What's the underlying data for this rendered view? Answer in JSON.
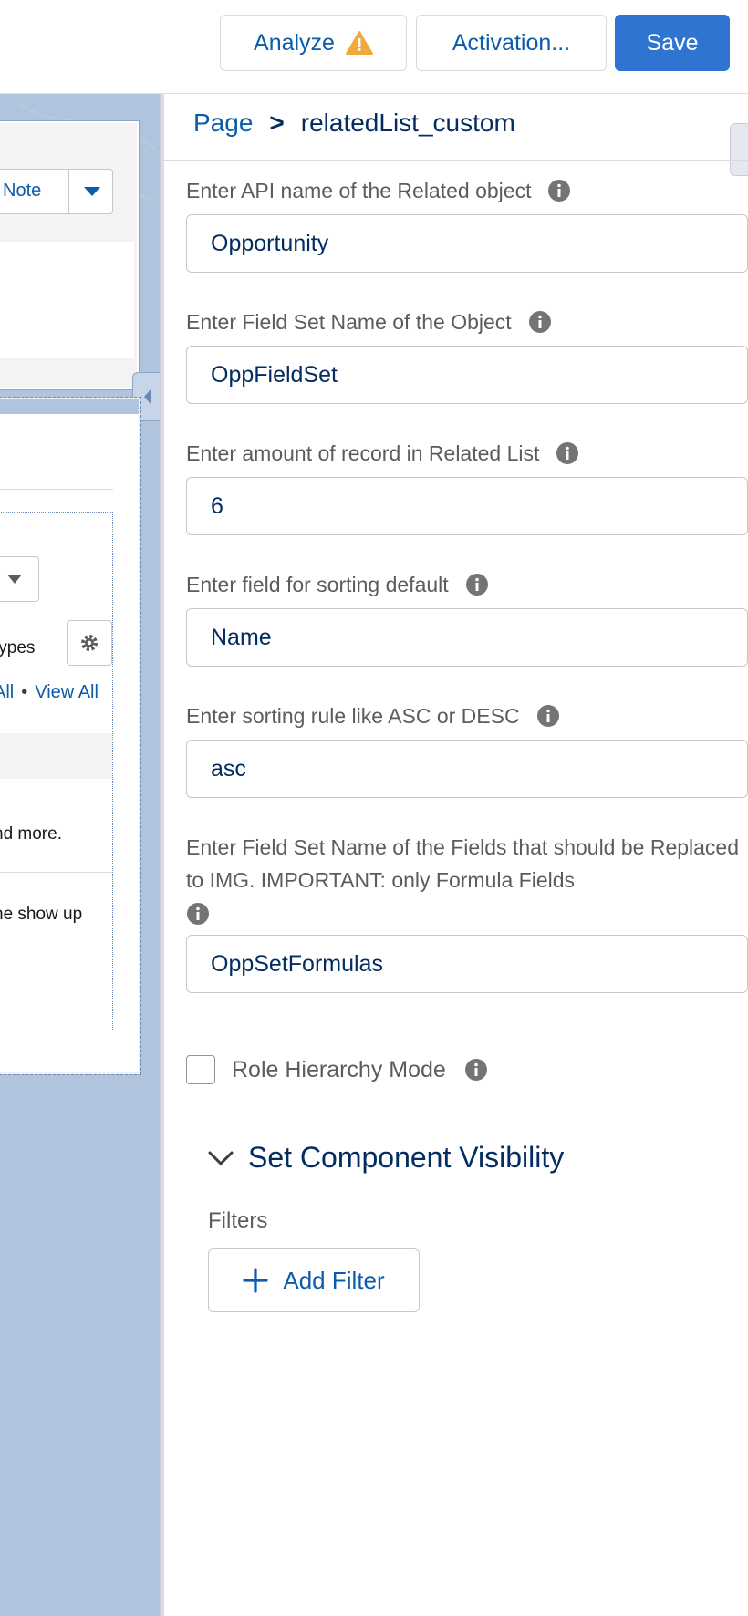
{
  "toolbar": {
    "analyze_label": "Analyze",
    "activation_label": "Activation...",
    "save_label": "Save"
  },
  "canvas": {
    "note_button_label": "Note",
    "types_text": "types",
    "link_all": "All",
    "link_view_all": "View All",
    "more_text": "nd more.",
    "show_up_text": "he show up"
  },
  "panel": {
    "breadcrumb": {
      "parent": "Page",
      "separator": ">",
      "current": "relatedList_custom"
    },
    "fields": [
      {
        "label": "Enter API name of the Related object",
        "value": "Opportunity"
      },
      {
        "label": "Enter Field Set Name of the Object",
        "value": "OppFieldSet"
      },
      {
        "label": "Enter amount of record in Related List",
        "value": "6"
      },
      {
        "label": "Enter field for sorting default",
        "value": "Name"
      },
      {
        "label": "Enter sorting rule like ASC or DESC",
        "value": "asc"
      },
      {
        "label": "Enter Field Set Name of the Fields that should be Replaced to IMG. IMPORTANT: only Formula Fields",
        "value": "OppSetFormulas"
      }
    ],
    "role_hierarchy_label": "Role Hierarchy Mode",
    "role_hierarchy_checked": false,
    "visibility_section_title": "Set Component Visibility",
    "filters_label": "Filters",
    "add_filter_label": "Add Filter"
  },
  "colors": {
    "brand_blue": "#0b5cab",
    "save_button_bg": "#2e74d0",
    "canvas_bg": "#b1c4de",
    "warning": "#f2a93b",
    "input_text": "#032d60"
  },
  "icons": [
    "warning-icon",
    "chevron-down-icon",
    "gear-icon",
    "info-icon",
    "plus-icon",
    "chevron-left-icon"
  ]
}
